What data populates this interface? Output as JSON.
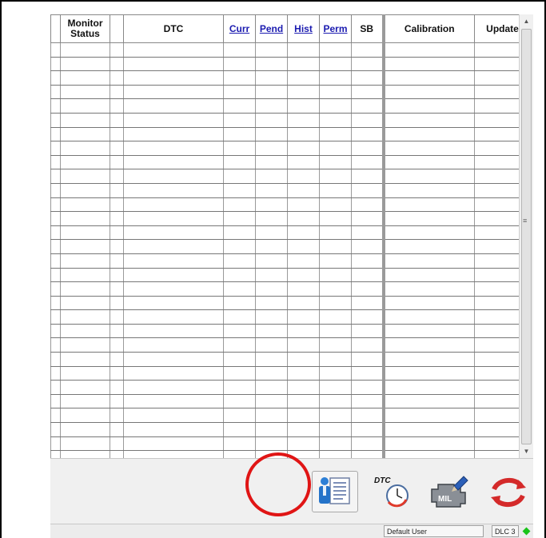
{
  "table": {
    "columns": [
      {
        "key": "monitor_status",
        "label": "Monitor Status",
        "link": false
      },
      {
        "key": "blank",
        "label": "",
        "link": false
      },
      {
        "key": "dtc",
        "label": "DTC",
        "link": false
      },
      {
        "key": "curr",
        "label": "Curr",
        "link": true
      },
      {
        "key": "pend",
        "label": "Pend",
        "link": true
      },
      {
        "key": "hist",
        "label": "Hist",
        "link": true
      },
      {
        "key": "perm",
        "label": "Perm",
        "link": true
      },
      {
        "key": "sb",
        "label": "SB",
        "link": false
      },
      {
        "key": "calibration",
        "label": "Calibration",
        "link": false
      },
      {
        "key": "update",
        "label": "Update",
        "link": false
      }
    ],
    "row_count": 30
  },
  "scrollbar": {
    "up_glyph": "▲",
    "down_glyph": "▼",
    "grip_glyph": "≡"
  },
  "toolbar": {
    "buttons": [
      {
        "name": "report-button",
        "icon": "person-document-icon",
        "highlighted": true
      },
      {
        "name": "dtc-clear-button",
        "icon": "dtc-clock-icon",
        "label": "DTC"
      },
      {
        "name": "mil-button",
        "icon": "engine-mil-icon",
        "label": "MIL"
      },
      {
        "name": "refresh-button",
        "icon": "refresh-arrows-icon"
      }
    ]
  },
  "statusbar": {
    "user": "Default User",
    "connection": "DLC 3",
    "connection_status_color": "#19c419"
  }
}
